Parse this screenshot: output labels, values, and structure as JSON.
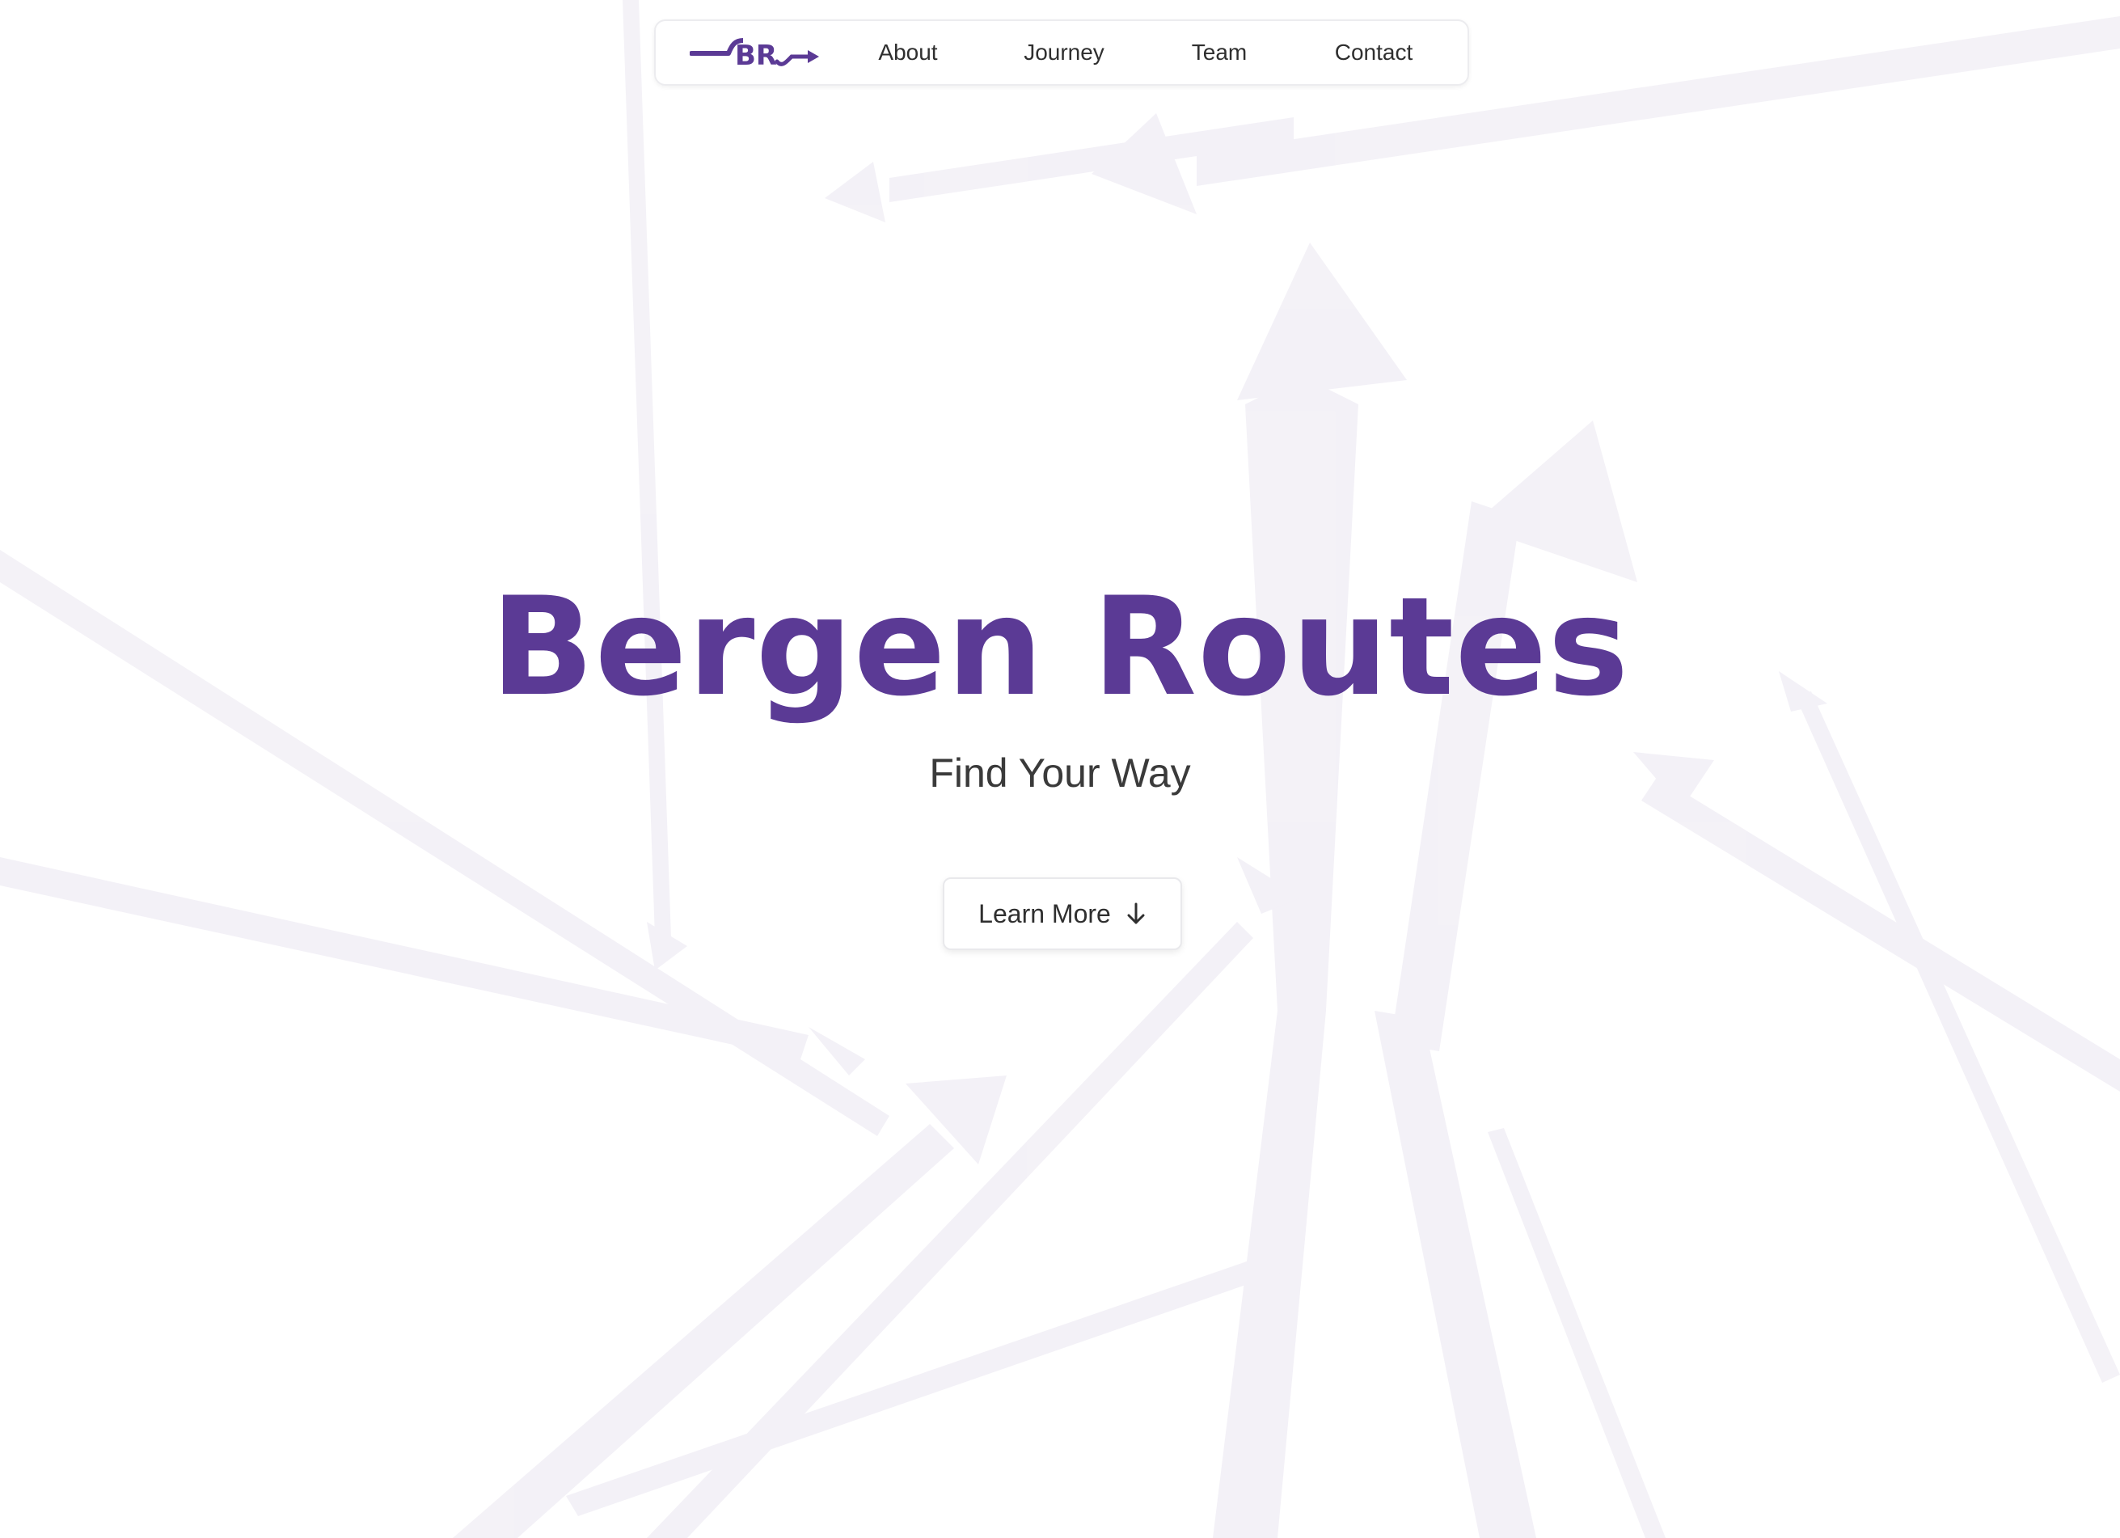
{
  "nav": {
    "logo_text": "BR",
    "links": [
      "About",
      "Journey",
      "Team",
      "Contact"
    ]
  },
  "hero": {
    "title": "Bergen Routes",
    "subtitle": "Find Your Way",
    "cta_label": "Learn More",
    "cta_icon": "arrow-down-icon"
  },
  "colors": {
    "brand_purple": "#5b3a95",
    "background": "#ffffff",
    "text_dark": "#2f2f2f"
  }
}
